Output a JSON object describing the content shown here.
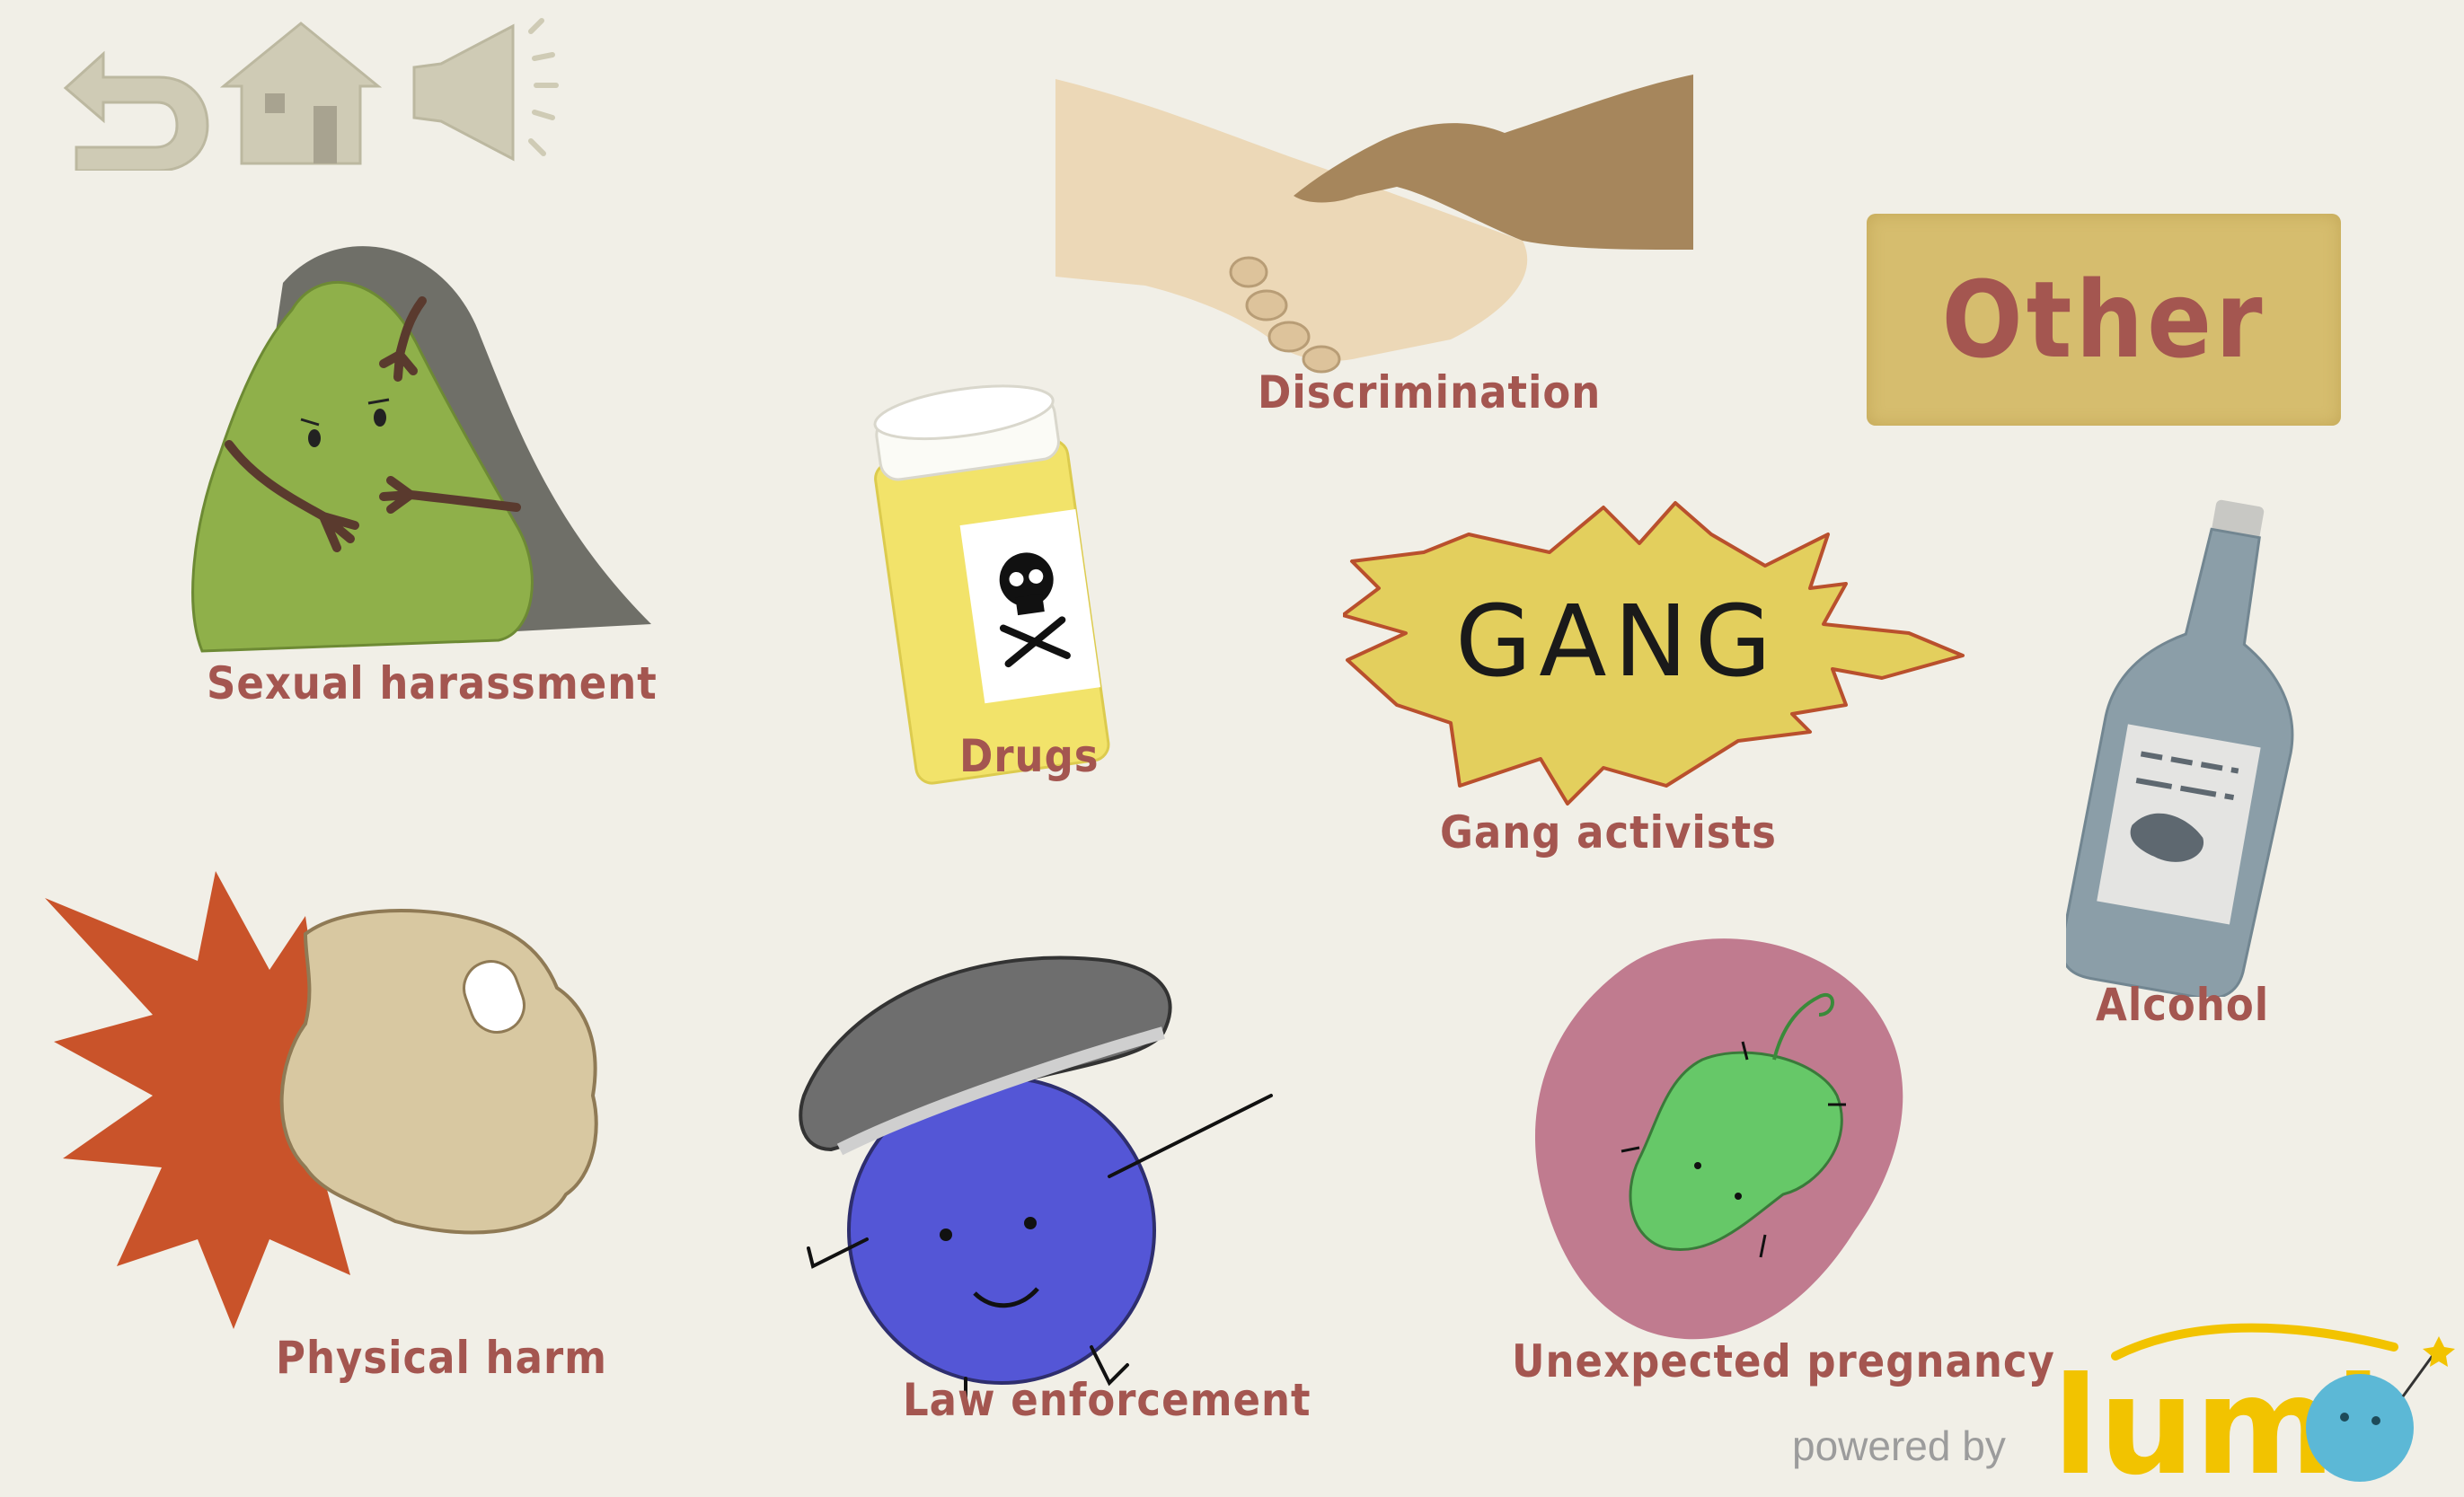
{
  "nav": {
    "back_icon": "undo-arrow-icon",
    "home_icon": "house-icon",
    "sound_icon": "speaker-icon"
  },
  "topics": {
    "sexual_harassment": "Sexual harassment",
    "drugs": "Drugs",
    "discrimination": "Discrimination",
    "gang_activists": "Gang activists",
    "gang_sign_text": "GANG",
    "alcohol": "Alcohol",
    "physical_harm": "Physical harm",
    "law_enforcement": "Law enforcement",
    "unexpected_pregnancy": "Unexpected pregnancy",
    "other": "Other"
  },
  "footer": {
    "powered_by": "powered by",
    "brand": "lumi"
  },
  "colors": {
    "background": "#f1efe7",
    "label": "#a45650",
    "other_button": "#d6bd6e",
    "brand_yellow": "#f2c300",
    "brand_blue": "#5cb8d6"
  }
}
